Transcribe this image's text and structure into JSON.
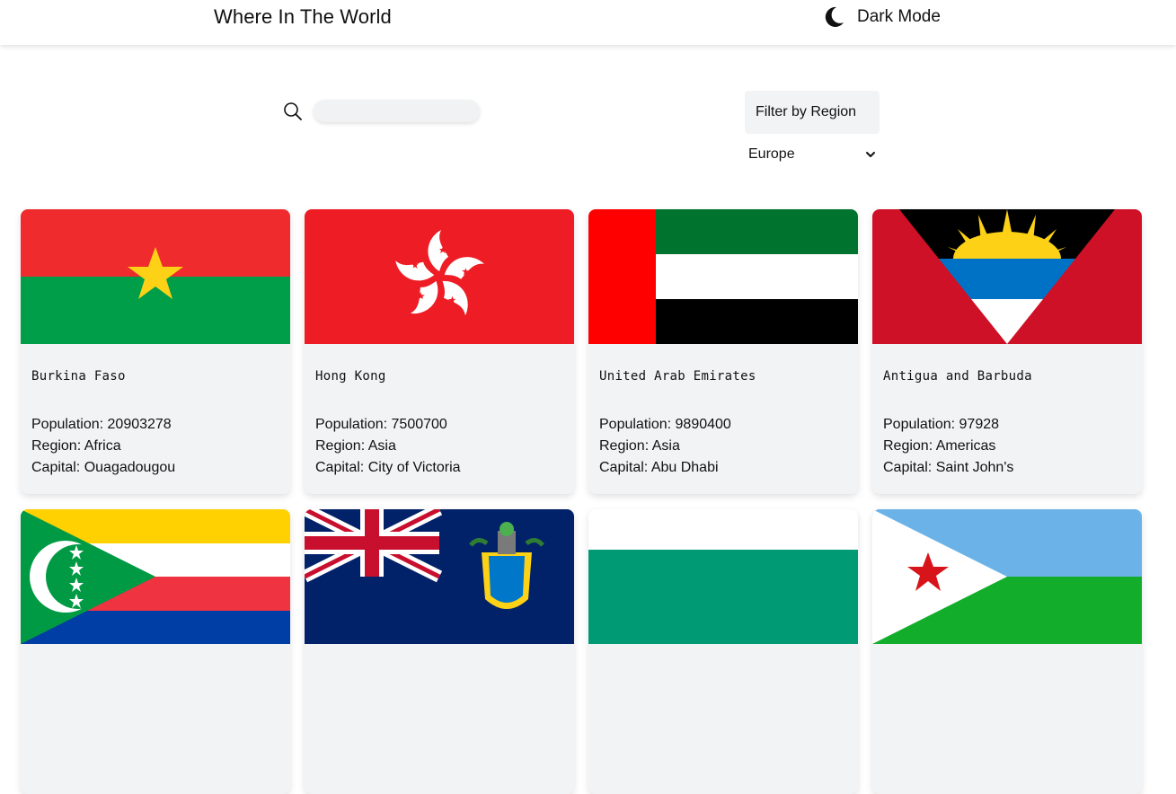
{
  "header": {
    "title": "Where In The World",
    "dark_mode_label": "Dark Mode"
  },
  "search": {
    "placeholder": ""
  },
  "filter": {
    "label": "Filter by Region",
    "selected": "Europe"
  },
  "labels": {
    "population": "Population: ",
    "region": "Region: ",
    "capital": "Capital: "
  },
  "countries": [
    {
      "name": "Burkina Faso",
      "population": "20903278",
      "region": "Africa",
      "capital": "Ouagadougou"
    },
    {
      "name": "Hong Kong",
      "population": "7500700",
      "region": "Asia",
      "capital": "City of Victoria"
    },
    {
      "name": "United Arab Emirates",
      "population": "9890400",
      "region": "Asia",
      "capital": "Abu Dhabi"
    },
    {
      "name": "Antigua and Barbuda",
      "population": "97928",
      "region": "Americas",
      "capital": "Saint John's"
    },
    {
      "name": "",
      "population": "",
      "region": "",
      "capital": ""
    },
    {
      "name": "",
      "population": "",
      "region": "",
      "capital": ""
    },
    {
      "name": "",
      "population": "",
      "region": "",
      "capital": ""
    },
    {
      "name": "",
      "population": "",
      "region": "",
      "capital": ""
    }
  ],
  "icons": {
    "dark_mode": "moon-icon",
    "search": "search-icon",
    "dropdown": "chevron-down-icon"
  }
}
